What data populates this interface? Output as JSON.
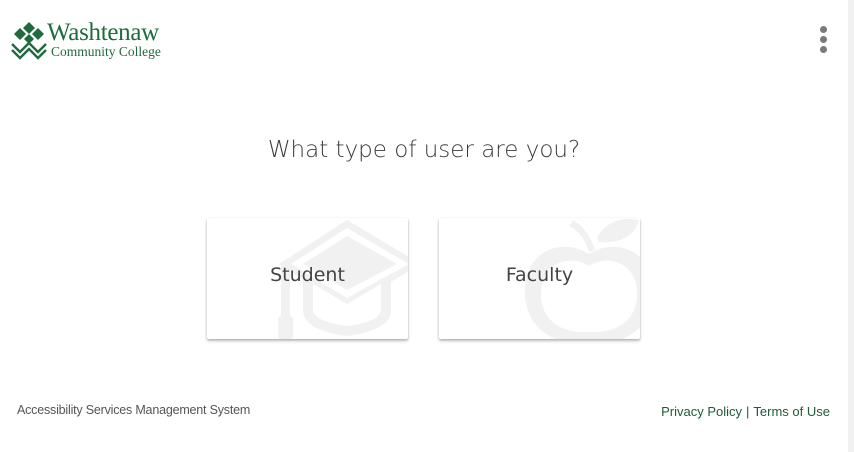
{
  "header": {
    "logo": {
      "name": "Washtenaw",
      "subtitle": "Community College",
      "icon": "wcc-logo-icon",
      "color": "#1f6b3e"
    },
    "menu_icon": "more-vert-icon"
  },
  "main": {
    "question": "What type of user are you?",
    "options": [
      {
        "label": "Student",
        "icon": "graduation-cap-icon"
      },
      {
        "label": "Faculty",
        "icon": "apple-icon"
      }
    ]
  },
  "footer": {
    "system_name": "Accessibility Services Management System",
    "links": {
      "privacy": "Privacy Policy",
      "separator": "|",
      "terms": "Terms of Use"
    },
    "link_color": "#1f5a3a"
  }
}
